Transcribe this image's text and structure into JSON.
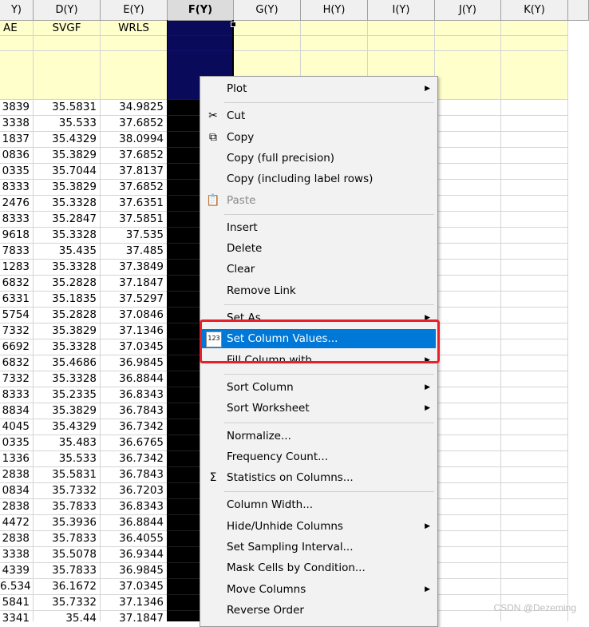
{
  "columns": [
    {
      "header": "Y)",
      "label": "AE",
      "values": [
        "3839",
        "3338",
        "1837",
        "0836",
        "0335",
        "8333",
        "2476",
        "8333",
        "9618",
        "7833",
        "1283",
        "6832",
        "6331",
        "5754",
        "7332",
        "6692",
        "6832",
        "7332",
        "8333",
        "8834",
        "4045",
        "0335",
        "1336",
        "2838",
        "0834",
        "2838",
        "4472",
        "2838",
        "3338",
        "4339",
        "6.534",
        "5841",
        "3341"
      ]
    },
    {
      "header": "D(Y)",
      "label": "SVGF",
      "values": [
        "35.5831",
        "35.533",
        "35.4329",
        "35.3829",
        "35.7044",
        "35.3829",
        "35.3328",
        "35.2847",
        "35.3328",
        "35.435",
        "35.3328",
        "35.2828",
        "35.1835",
        "35.2828",
        "35.3829",
        "35.3328",
        "35.4686",
        "35.3328",
        "35.2335",
        "35.3829",
        "35.4329",
        "35.483",
        "35.533",
        "35.5831",
        "35.7332",
        "35.7833",
        "35.3936",
        "35.7833",
        "35.5078",
        "35.7833",
        "36.1672",
        "35.7332",
        "35.44"
      ]
    },
    {
      "header": "E(Y)",
      "label": "WRLS",
      "values": [
        "34.9825",
        "37.6852",
        "38.0994",
        "37.6852",
        "37.8137",
        "37.6852",
        "37.6351",
        "37.5851",
        "37.535",
        "37.485",
        "37.3849",
        "37.1847",
        "37.5297",
        "37.0846",
        "37.1346",
        "37.0345",
        "36.9845",
        "36.8844",
        "36.8343",
        "36.7843",
        "36.7342",
        "36.6765",
        "36.7342",
        "36.7843",
        "36.7203",
        "36.8343",
        "36.8844",
        "36.4055",
        "36.9344",
        "36.9845",
        "37.0345",
        "37.1346",
        "37.1847"
      ]
    },
    {
      "header": "F(Y)",
      "label": "",
      "values": []
    },
    {
      "header": "G(Y)",
      "label": "",
      "values": []
    },
    {
      "header": "H(Y)",
      "label": "",
      "values": []
    },
    {
      "header": "I(Y)",
      "label": "",
      "values": []
    },
    {
      "header": "J(Y)",
      "label": "",
      "values": []
    },
    {
      "header": "K(Y)",
      "label": "",
      "values": []
    }
  ],
  "selected_column": "F(Y)",
  "context_menu": {
    "items": [
      {
        "type": "item",
        "label": "Plot",
        "submenu": true
      },
      {
        "type": "sep"
      },
      {
        "type": "item",
        "label": "Cut",
        "icon": "scissors-icon",
        "glyph": "✂"
      },
      {
        "type": "item",
        "label": "Copy",
        "icon": "copy-icon",
        "glyph": "⧉"
      },
      {
        "type": "item",
        "label": "Copy (full precision)"
      },
      {
        "type": "item",
        "label": "Copy (including label rows)"
      },
      {
        "type": "item",
        "label": "Paste",
        "icon": "paste-icon",
        "glyph": "📋",
        "disabled": true
      },
      {
        "type": "sep"
      },
      {
        "type": "item",
        "label": "Insert"
      },
      {
        "type": "item",
        "label": "Delete"
      },
      {
        "type": "item",
        "label": "Clear"
      },
      {
        "type": "item",
        "label": "Remove Link"
      },
      {
        "type": "sep"
      },
      {
        "type": "item",
        "label": "Set As",
        "submenu": true
      },
      {
        "type": "item",
        "label": "Set Column Values...",
        "icon": "set-values-icon",
        "glyph": "123",
        "highlight": true
      },
      {
        "type": "item",
        "label": "Fill Column with",
        "submenu": true
      },
      {
        "type": "sep"
      },
      {
        "type": "item",
        "label": "Sort Column",
        "submenu": true
      },
      {
        "type": "item",
        "label": "Sort Worksheet",
        "submenu": true
      },
      {
        "type": "sep"
      },
      {
        "type": "item",
        "label": "Normalize..."
      },
      {
        "type": "item",
        "label": "Frequency Count..."
      },
      {
        "type": "item",
        "label": "Statistics on Columns...",
        "icon": "sigma-icon",
        "glyph": "Σ"
      },
      {
        "type": "sep"
      },
      {
        "type": "item",
        "label": "Column Width..."
      },
      {
        "type": "item",
        "label": "Hide/Unhide Columns",
        "submenu": true
      },
      {
        "type": "item",
        "label": "Set Sampling Interval..."
      },
      {
        "type": "item",
        "label": "Mask Cells by Condition..."
      },
      {
        "type": "item",
        "label": "Move Columns",
        "submenu": true
      },
      {
        "type": "item",
        "label": "Reverse Order"
      }
    ]
  },
  "watermark": "CSDN @Dezeming",
  "colors": {
    "highlight": "#0078d7",
    "annotation_box": "#e8202a",
    "label_row": "#ffffcc",
    "selected_column": "#000000"
  }
}
